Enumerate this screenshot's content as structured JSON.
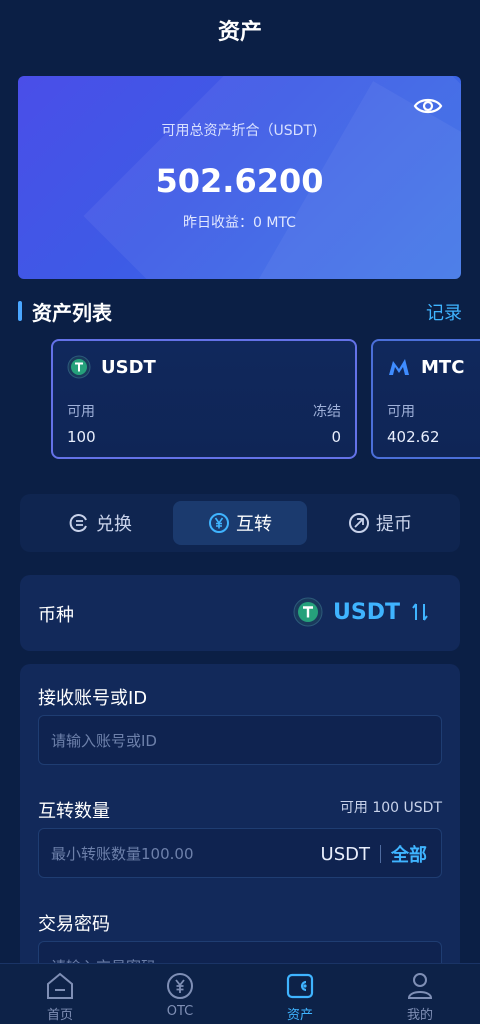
{
  "header": {
    "title": "资产"
  },
  "hero": {
    "label": "可用总资产折合（USDT)",
    "value": "502.6200",
    "sub": "昨日收益：0 MTC",
    "eye_icon": "eye-icon"
  },
  "assets": {
    "title": "资产列表",
    "records_label": "记录",
    "cards": [
      {
        "coin": "USDT",
        "available_label": "可用",
        "available": "100",
        "frozen_label": "冻结",
        "frozen": "0"
      },
      {
        "coin": "MTC",
        "available_label": "可用",
        "available": "402.62"
      }
    ]
  },
  "tabs": [
    {
      "label": "兑换",
      "icon": "exchange-icon"
    },
    {
      "label": "互转",
      "icon": "yen-circle-icon",
      "active": true
    },
    {
      "label": "提币",
      "icon": "withdraw-icon"
    }
  ],
  "coin_select": {
    "label": "币种",
    "value": "USDT",
    "toggle_icon": "swap-vertical-icon"
  },
  "form": {
    "receiver_label": "接收账号或ID",
    "receiver_placeholder": "请输入账号或ID",
    "amount_label": "互转数量",
    "available_text": "可用 100 USDT",
    "amount_placeholder": "最小转账数量100.00",
    "amount_unit": "USDT",
    "all_label": "全部",
    "password_label": "交易密码",
    "password_placeholder": "请输入交易密码"
  },
  "bottom_nav": [
    {
      "label": "首页",
      "icon": "home-icon"
    },
    {
      "label": "OTC",
      "icon": "otc-icon"
    },
    {
      "label": "资产",
      "icon": "wallet-icon",
      "active": true
    },
    {
      "label": "我的",
      "icon": "user-icon"
    }
  ],
  "colors": {
    "accent": "#3fb4ff",
    "background": "#0b1f45",
    "panel": "#12295a",
    "tether_green": "#26a17b"
  }
}
